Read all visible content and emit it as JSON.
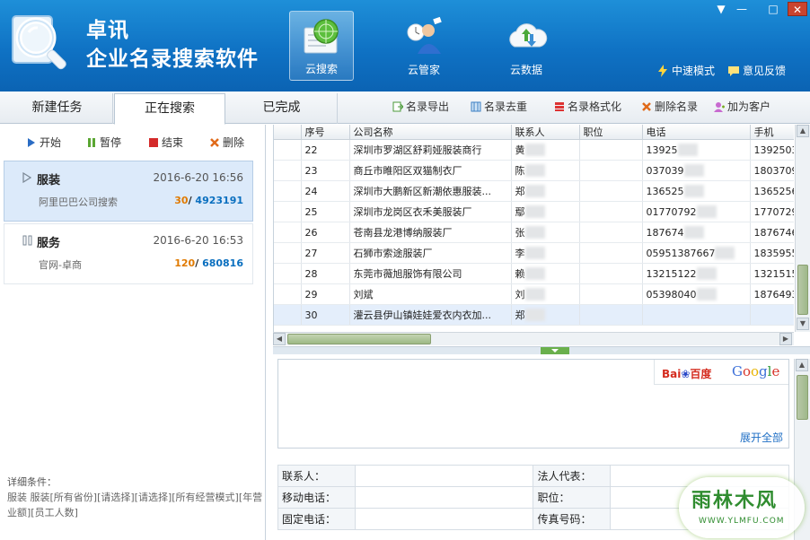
{
  "header": {
    "title_line1": "卓讯",
    "title_line2": "企业名录搜索软件",
    "nav": [
      {
        "label": "云搜索",
        "icon": "radar-search-icon",
        "active": true
      },
      {
        "label": "云管家",
        "icon": "user-manager-icon",
        "active": false
      },
      {
        "label": "云数据",
        "icon": "cloud-sync-icon",
        "active": false
      }
    ],
    "mode_label": "中速模式",
    "feedback_label": "意见反馈",
    "window_controls": [
      "▼",
      "—",
      "□",
      "✕"
    ]
  },
  "tabs": [
    "新建任务",
    "正在搜索",
    "已完成"
  ],
  "toolbar": [
    "名录导出",
    "名录去重",
    "名录格式化",
    "删除名录",
    "加为客户"
  ],
  "actions": [
    "开始",
    "暂停",
    "结束",
    "删除"
  ],
  "tasks": [
    {
      "name": "服装",
      "date": "2016-6-20 16:56",
      "source": "阿里巴巴公司搜索",
      "found": "30",
      "total": "4923191"
    },
    {
      "name": "服务",
      "date": "2016-6-20 16:53",
      "source": "官网-卓商",
      "found": "120",
      "total": "680816"
    }
  ],
  "detail": {
    "label": "详细条件：",
    "text": "服装 服装[所有省份][请选择][请选择][所有经营模式][年营业额][员工人数]"
  },
  "table": {
    "columns": [
      "序号",
      "公司名称",
      "联系人",
      "职位",
      "电话",
      "手机"
    ],
    "rows": [
      [
        "22",
        "深圳市罗湖区舒莉娅服装商行",
        "黄",
        "",
        "13925",
        "1392503"
      ],
      [
        "23",
        "商丘市睢阳区双猫制衣厂",
        "陈",
        "",
        "037039",
        "1803709"
      ],
      [
        "24",
        "深圳市大鹏新区新潮依惠服装...",
        "郑",
        "",
        "136525",
        "1365256"
      ],
      [
        "25",
        "深圳市龙岗区衣禾美服装厂",
        "鄢",
        "",
        "01770792",
        "1770729"
      ],
      [
        "26",
        "苍南县龙港博纳服装厂",
        "张",
        "",
        "187674",
        "1876746"
      ],
      [
        "27",
        "石狮市索途服装厂",
        "李",
        "",
        "05951387667",
        "1835955"
      ],
      [
        "28",
        "东莞市薇旭服饰有限公司",
        "赖",
        "",
        "13215122",
        "1321515"
      ],
      [
        "29",
        "刘斌",
        "刘",
        "",
        "05398040",
        "1876493"
      ],
      [
        "30",
        "灌云县伊山镇娃娃爱衣内衣加...",
        "郑",
        "",
        "",
        ""
      ]
    ],
    "selected_row": 8
  },
  "search_panel": {
    "baidu_a": "Bai",
    "baidu_b": "百度",
    "google": "Google",
    "expand_label": "展开全部"
  },
  "info_fields": [
    [
      "联系人：",
      "法人代表："
    ],
    [
      "移动电话：",
      "职位："
    ],
    [
      "固定电话：",
      "传真号码："
    ]
  ],
  "watermark": {
    "line1": "雨林木风",
    "line2": "WWW.YLMFU.COM"
  }
}
